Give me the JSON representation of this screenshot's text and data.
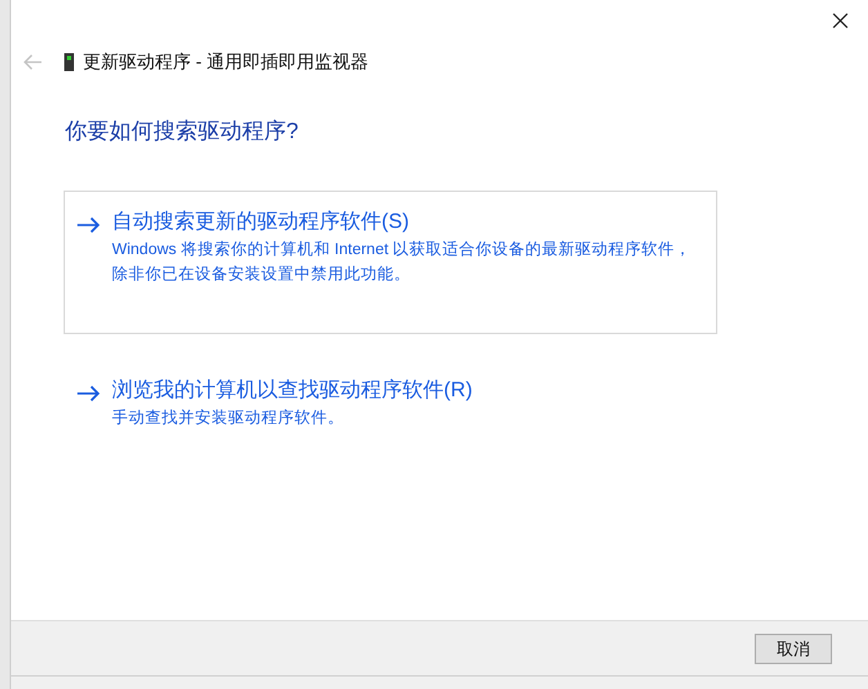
{
  "window": {
    "title": "更新驱动程序 - 通用即插即用监视器"
  },
  "back_button": {
    "disabled": true
  },
  "heading": "你要如何搜索驱动程序?",
  "options": [
    {
      "title": "自动搜索更新的驱动程序软件(S)",
      "description": "Windows 将搜索你的计算机和 Internet 以获取适合你设备的最新驱动程序软件，除非你已在设备安装设置中禁用此功能。",
      "selected": true
    },
    {
      "title": "浏览我的计算机以查找驱动程序软件(R)",
      "description": "手动查找并安装驱动程序软件。",
      "selected": false
    }
  ],
  "buttons": [
    "取消"
  ]
}
